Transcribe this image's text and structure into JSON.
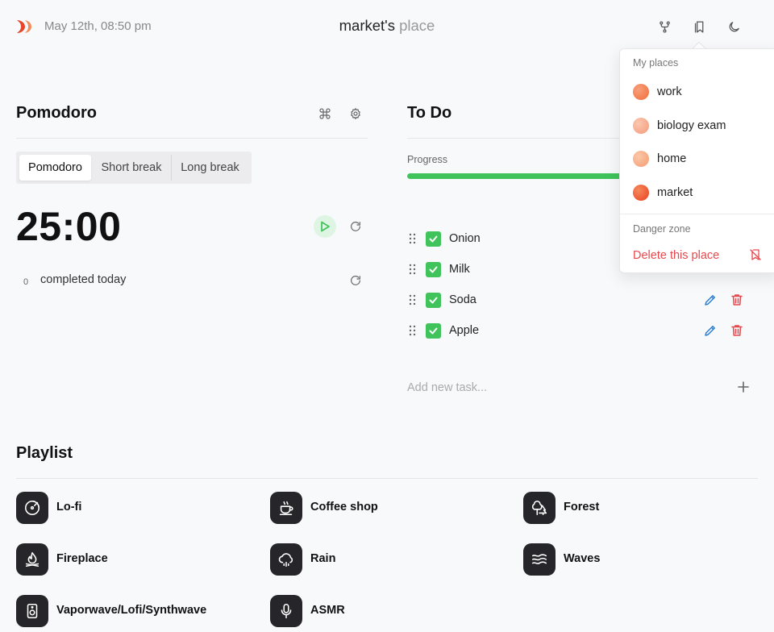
{
  "header": {
    "date": "May 12th, 08:50 pm",
    "title_main": "market's",
    "title_muted": "place"
  },
  "pomodoro": {
    "title": "Pomodoro",
    "tabs": [
      {
        "label": "Pomodoro",
        "active": true
      },
      {
        "label": "Short break",
        "active": false
      },
      {
        "label": "Long break",
        "active": false
      }
    ],
    "timer": "25:00",
    "completed_count": "0",
    "completed_label": "completed today"
  },
  "todo": {
    "title": "To Do",
    "progress_label": "Progress",
    "progress_percent": 100,
    "tasks": [
      {
        "label": "Onion",
        "done": true
      },
      {
        "label": "Milk",
        "done": true
      },
      {
        "label": "Soda",
        "done": true
      },
      {
        "label": "Apple",
        "done": true
      }
    ],
    "add_placeholder": "Add new task..."
  },
  "playlist": {
    "title": "Playlist",
    "items": [
      {
        "label": "Lo-fi",
        "icon": "vinyl-icon"
      },
      {
        "label": "Coffee shop",
        "icon": "coffee-icon"
      },
      {
        "label": "Forest",
        "icon": "trees-icon"
      },
      {
        "label": "Fireplace",
        "icon": "flame-icon"
      },
      {
        "label": "Rain",
        "icon": "cloud-rain-icon"
      },
      {
        "label": "Waves",
        "icon": "waves-icon"
      },
      {
        "label": "Vaporwave/Lofi/Synthwave",
        "icon": "speaker-icon"
      },
      {
        "label": "ASMR",
        "icon": "microphone-icon"
      }
    ]
  },
  "places_menu": {
    "heading": "My places",
    "places": [
      {
        "label": "work",
        "color": "#f26b3a"
      },
      {
        "label": "biology exam",
        "color": "#f49a7a"
      },
      {
        "label": "home",
        "color": "#f59b72"
      },
      {
        "label": "market",
        "color": "#ec3e1f"
      }
    ],
    "danger_heading": "Danger zone",
    "delete_label": "Delete this place"
  },
  "colors": {
    "accent_green": "#3fc35a",
    "danger_red": "#e5484d",
    "edit_blue": "#2b7fd4"
  }
}
